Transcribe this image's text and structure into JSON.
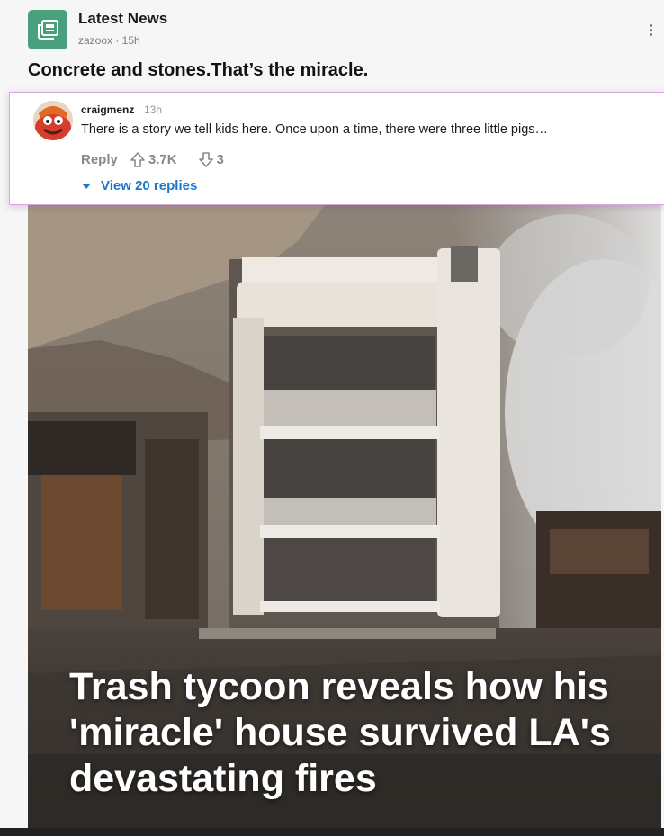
{
  "post": {
    "community_name": "Latest News",
    "meta": "zazoox · 15h",
    "title": "Concrete and stones.That’s the miracle.",
    "image_caption": "Trash tycoon reveals how his 'miracle' house survived LA's devastating fires"
  },
  "comment": {
    "author": "craigmenz",
    "time": "13h",
    "body": "There is a story we tell kids here. Once upon a time, there were three little pigs…",
    "reply_label": "Reply",
    "upvotes": "3.7K",
    "downvotes": "3",
    "view_replies_label": "View 20 replies"
  },
  "icons": {
    "community": "newspaper-icon",
    "more": "more-vertical-icon",
    "upvote": "arrow-up-icon",
    "downvote": "arrow-down-icon",
    "expand": "caret-down-icon"
  },
  "colors": {
    "community_icon_bg": "#47a17c",
    "link_blue": "#1b76d2",
    "popup_border": "#d7a9e0"
  }
}
